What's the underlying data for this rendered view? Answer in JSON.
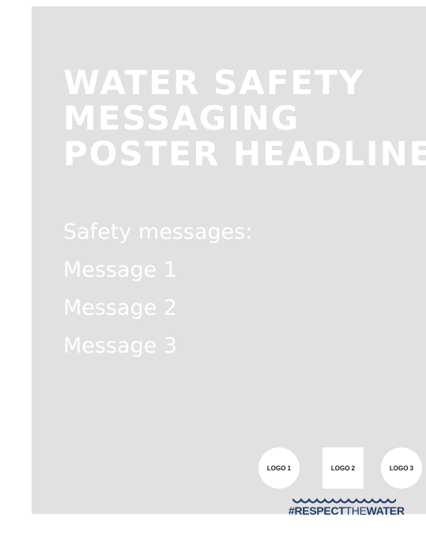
{
  "poster": {
    "headline": [
      "WATER SAFETY",
      "MESSAGING",
      "POSTER HEADLINE"
    ],
    "messages_title": "Safety messages:",
    "messages": [
      "Message 1",
      "Message 2",
      "Message 3"
    ],
    "logos": [
      "LOGO 1",
      "LOGO 2",
      "LOGO 3"
    ],
    "brand": {
      "prefix": "#RESPECT",
      "middle": "THE",
      "suffix": "WATER"
    },
    "colors": {
      "background": "#e1e1e1",
      "text": "#ffffff",
      "brand": "#1e3a6a"
    }
  }
}
